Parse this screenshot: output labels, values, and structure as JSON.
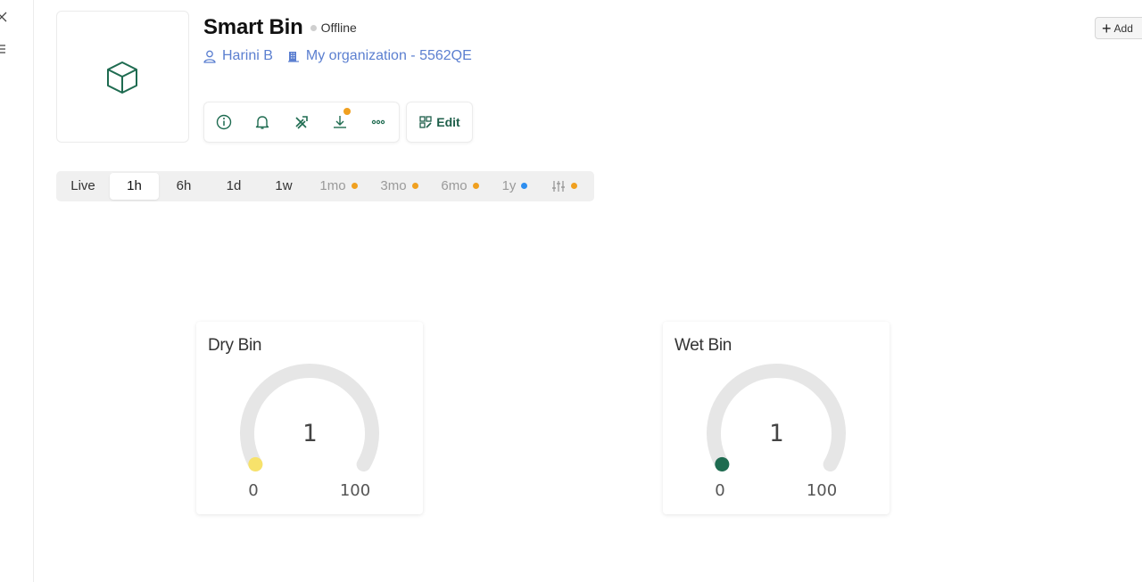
{
  "device": {
    "name": "Smart Bin",
    "status": "Offline",
    "owner": "Harini B",
    "organization": "My organization - 5562QE"
  },
  "toolbar": {
    "icons": [
      "info-icon",
      "bell-icon",
      "tools-icon",
      "download-icon",
      "more-icon"
    ],
    "edit_label": "Edit"
  },
  "header": {
    "add_label": "Add"
  },
  "time_ranges": [
    {
      "label": "Live"
    },
    {
      "label": "1h",
      "selected": true
    },
    {
      "label": "6h"
    },
    {
      "label": "1d"
    },
    {
      "label": "1w"
    },
    {
      "label": "1mo",
      "dot": "#f0a020"
    },
    {
      "label": "3mo",
      "dot": "#f0a020"
    },
    {
      "label": "6mo",
      "dot": "#f0a020"
    },
    {
      "label": "1y",
      "dot": "#2d8ef0"
    },
    {
      "icon": "sliders-icon",
      "dot": "#f0a020"
    }
  ],
  "gauges": [
    {
      "title": "Dry Bin",
      "value": 1,
      "min": 0,
      "max": 100,
      "color": "#f7e26b",
      "track": "#e6e6e6"
    },
    {
      "title": "Wet Bin",
      "value": 1,
      "min": 0,
      "max": 100,
      "color": "#1e6b50",
      "track": "#e6e6e6"
    }
  ],
  "colors": {
    "accent": "#1e6b50",
    "link": "#5b7fd0",
    "status_offline": "#cfcfcf",
    "notification": "#f0a020"
  }
}
